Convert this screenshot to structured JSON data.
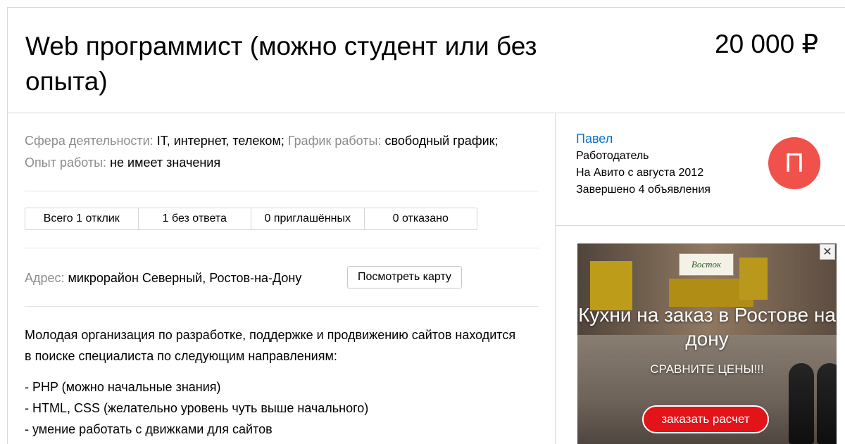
{
  "listing": {
    "title": "Web программист (можно студент или без опыта)",
    "price": "20 000 ₽"
  },
  "params": {
    "sphere_label": "Сфера деятельности:",
    "sphere_value": "IT, интернет, телеком;",
    "schedule_label": "График работы:",
    "schedule_value": "свободный график;",
    "experience_label": "Опыт работы:",
    "experience_value": "не имеет значения"
  },
  "stats": [
    {
      "label": "Всего 1 отклик"
    },
    {
      "label": "1 без ответа"
    },
    {
      "label": "0 приглашённых"
    },
    {
      "label": "0 отказано"
    }
  ],
  "address": {
    "label": "Адрес:",
    "value": "микрорайон Северный, Ростов-на-Дону",
    "map_button": "Посмотреть карту"
  },
  "description": {
    "intro": "Молодая организация по разработке, поддержке и продвижению сайтов находится в поиске специалиста по следующим направлениям:",
    "items": [
      "- PHP (можно начальные знания)",
      "- HTML, CSS (желательно уровень чуть выше начального)",
      "- умение работать с движками для сайтов"
    ]
  },
  "seller": {
    "name": "Павел",
    "role": "Работодатель",
    "since": "На Авито с августа 2012",
    "completed": "Завершено 4 объявления",
    "avatar_letter": "П"
  },
  "ad": {
    "logo": "Восток",
    "title": "Кухни на заказ в Ростове на дону",
    "subtitle": "СРАВНИТЕ ЦЕНЫ!!!",
    "cta": "заказать расчет",
    "close": "✕"
  },
  "colors": {
    "link": "#0a73cc",
    "avatar": "#f0524b",
    "cta": "#e3131a"
  }
}
